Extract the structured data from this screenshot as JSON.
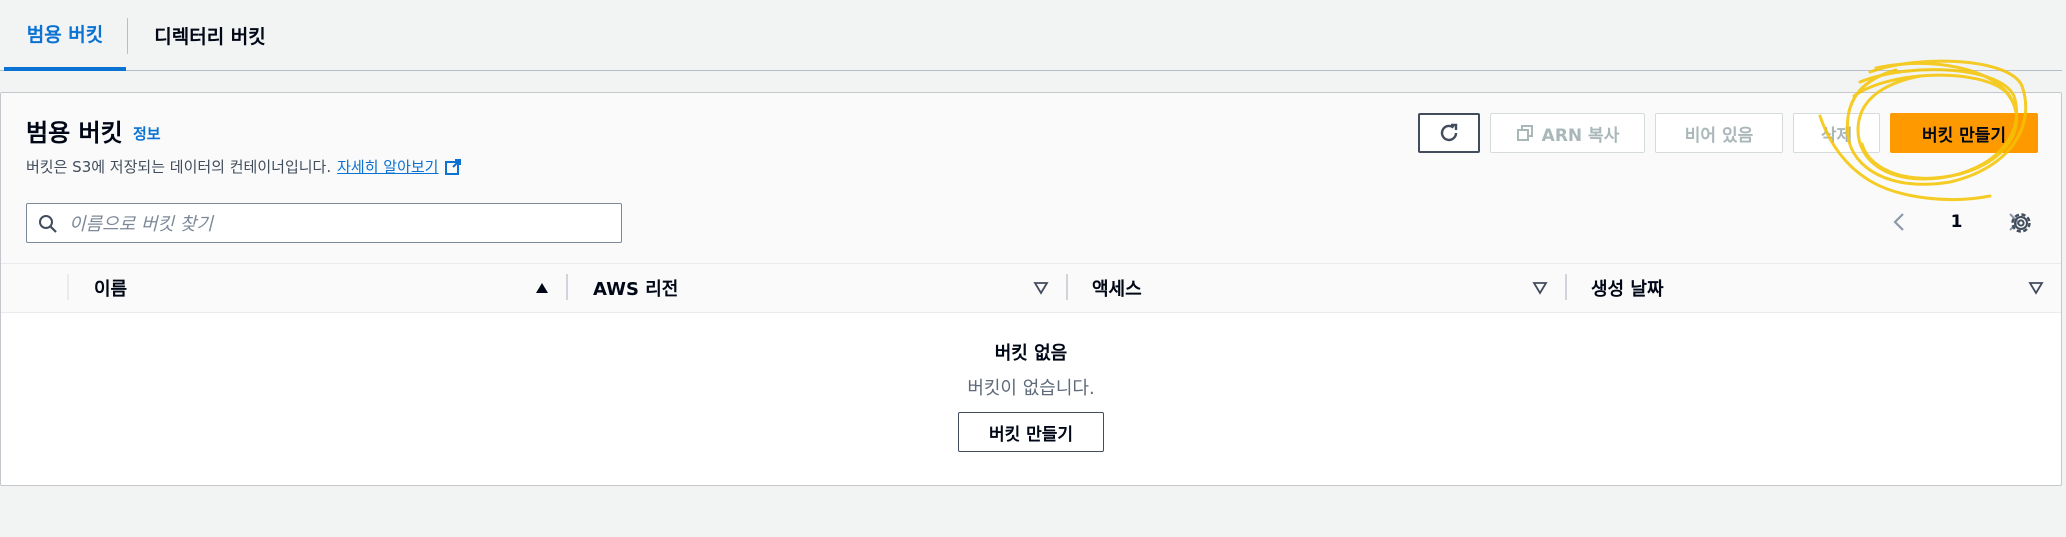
{
  "tabs": [
    {
      "label": "범용 버킷",
      "active": true
    },
    {
      "label": "디렉터리 버킷",
      "active": false
    }
  ],
  "panel": {
    "title": "범용 버킷",
    "info_label": "정보",
    "description": "버킷은 S3에 저장되는 데이터의 컨테이너입니다.",
    "learn_more": "자세히 알아보기"
  },
  "search": {
    "placeholder": "이름으로 버킷 찾기",
    "value": ""
  },
  "actions": {
    "refresh_icon": "refresh-icon",
    "copy_arn": "ARN 복사",
    "empty": "비어 있음",
    "delete": "삭제",
    "create": "버킷 만들기"
  },
  "pagination": {
    "current_page": "1"
  },
  "table": {
    "columns": [
      "이름",
      "AWS 리전",
      "액세스",
      "생성 날짜"
    ]
  },
  "empty_state": {
    "title": "버킷 없음",
    "description": "버킷이 없습니다.",
    "button": "버킷 만들기"
  },
  "colors": {
    "accent": "#0972d3",
    "primary_button": "#ff9900",
    "annotation": "#f5c400"
  }
}
